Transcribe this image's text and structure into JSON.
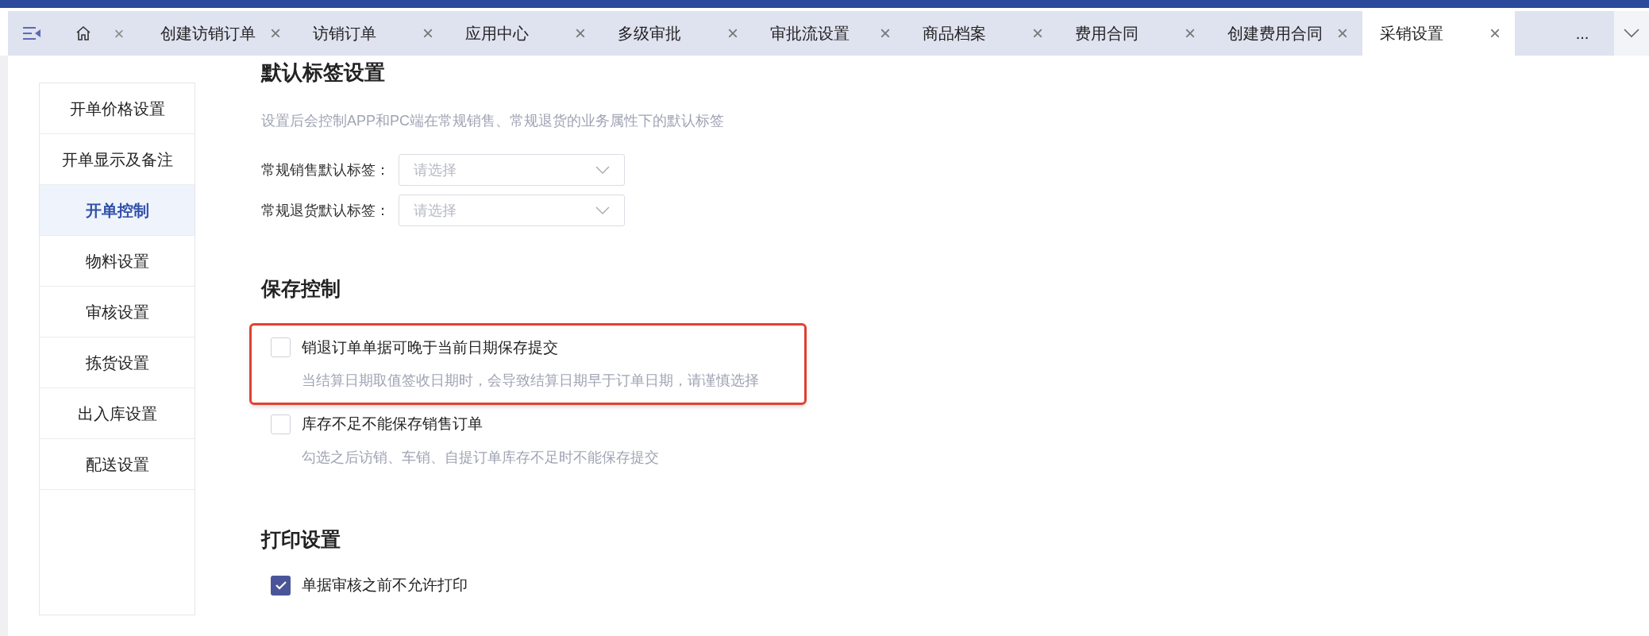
{
  "tabs": [
    {
      "kind": "home",
      "close": "×",
      "selected": false
    },
    {
      "kind": "text",
      "label": "创建访销订单",
      "close": "×",
      "selected": false
    },
    {
      "kind": "text",
      "label": "访销订单",
      "close": "×",
      "selected": false
    },
    {
      "kind": "text",
      "label": "应用中心",
      "close": "×",
      "selected": false
    },
    {
      "kind": "text",
      "label": "多级审批",
      "close": "×",
      "selected": false
    },
    {
      "kind": "text",
      "label": "审批流设置",
      "close": "×",
      "selected": false
    },
    {
      "kind": "text",
      "label": "商品档案",
      "close": "×",
      "selected": false
    },
    {
      "kind": "text",
      "label": "费用合同",
      "close": "×",
      "selected": false
    },
    {
      "kind": "text",
      "label": "创建费用合同",
      "close": "×",
      "selected": false
    },
    {
      "kind": "text",
      "label": "采销设置",
      "close": "×",
      "selected": true
    }
  ],
  "more_tabs": "...",
  "sidebar": {
    "items": [
      {
        "label": "开单价格设置",
        "selected": false
      },
      {
        "label": "开单显示及备注",
        "selected": false
      },
      {
        "label": "开单控制",
        "selected": true
      },
      {
        "label": "物料设置",
        "selected": false
      },
      {
        "label": "审核设置",
        "selected": false
      },
      {
        "label": "拣货设置",
        "selected": false
      },
      {
        "label": "出入库设置",
        "selected": false
      },
      {
        "label": "配送设置",
        "selected": false
      }
    ]
  },
  "default_tags": {
    "title": "默认标签设置",
    "description": "设置后会控制APP和PC端在常规销售、常规退货的业务属性下的默认标签",
    "fields": [
      {
        "label": "常规销售默认标签：",
        "placeholder": "请选择"
      },
      {
        "label": "常规退货默认标签：",
        "placeholder": "请选择"
      }
    ]
  },
  "save_control": {
    "title": "保存控制",
    "options": [
      {
        "label": "销退订单单据可晚于当前日期保存提交",
        "description": "当结算日期取值签收日期时，会导致结算日期早于订单日期，请谨慎选择",
        "checked": false,
        "highlighted": true
      },
      {
        "label": "库存不足不能保存销售订单",
        "description": "勾选之后访销、车销、自提订单库存不足时不能保存提交",
        "checked": false,
        "highlighted": false
      }
    ]
  },
  "print_settings": {
    "title": "打印设置",
    "options": [
      {
        "label": "单据审核之前不允许打印",
        "checked": true,
        "highlighted": false
      }
    ]
  }
}
